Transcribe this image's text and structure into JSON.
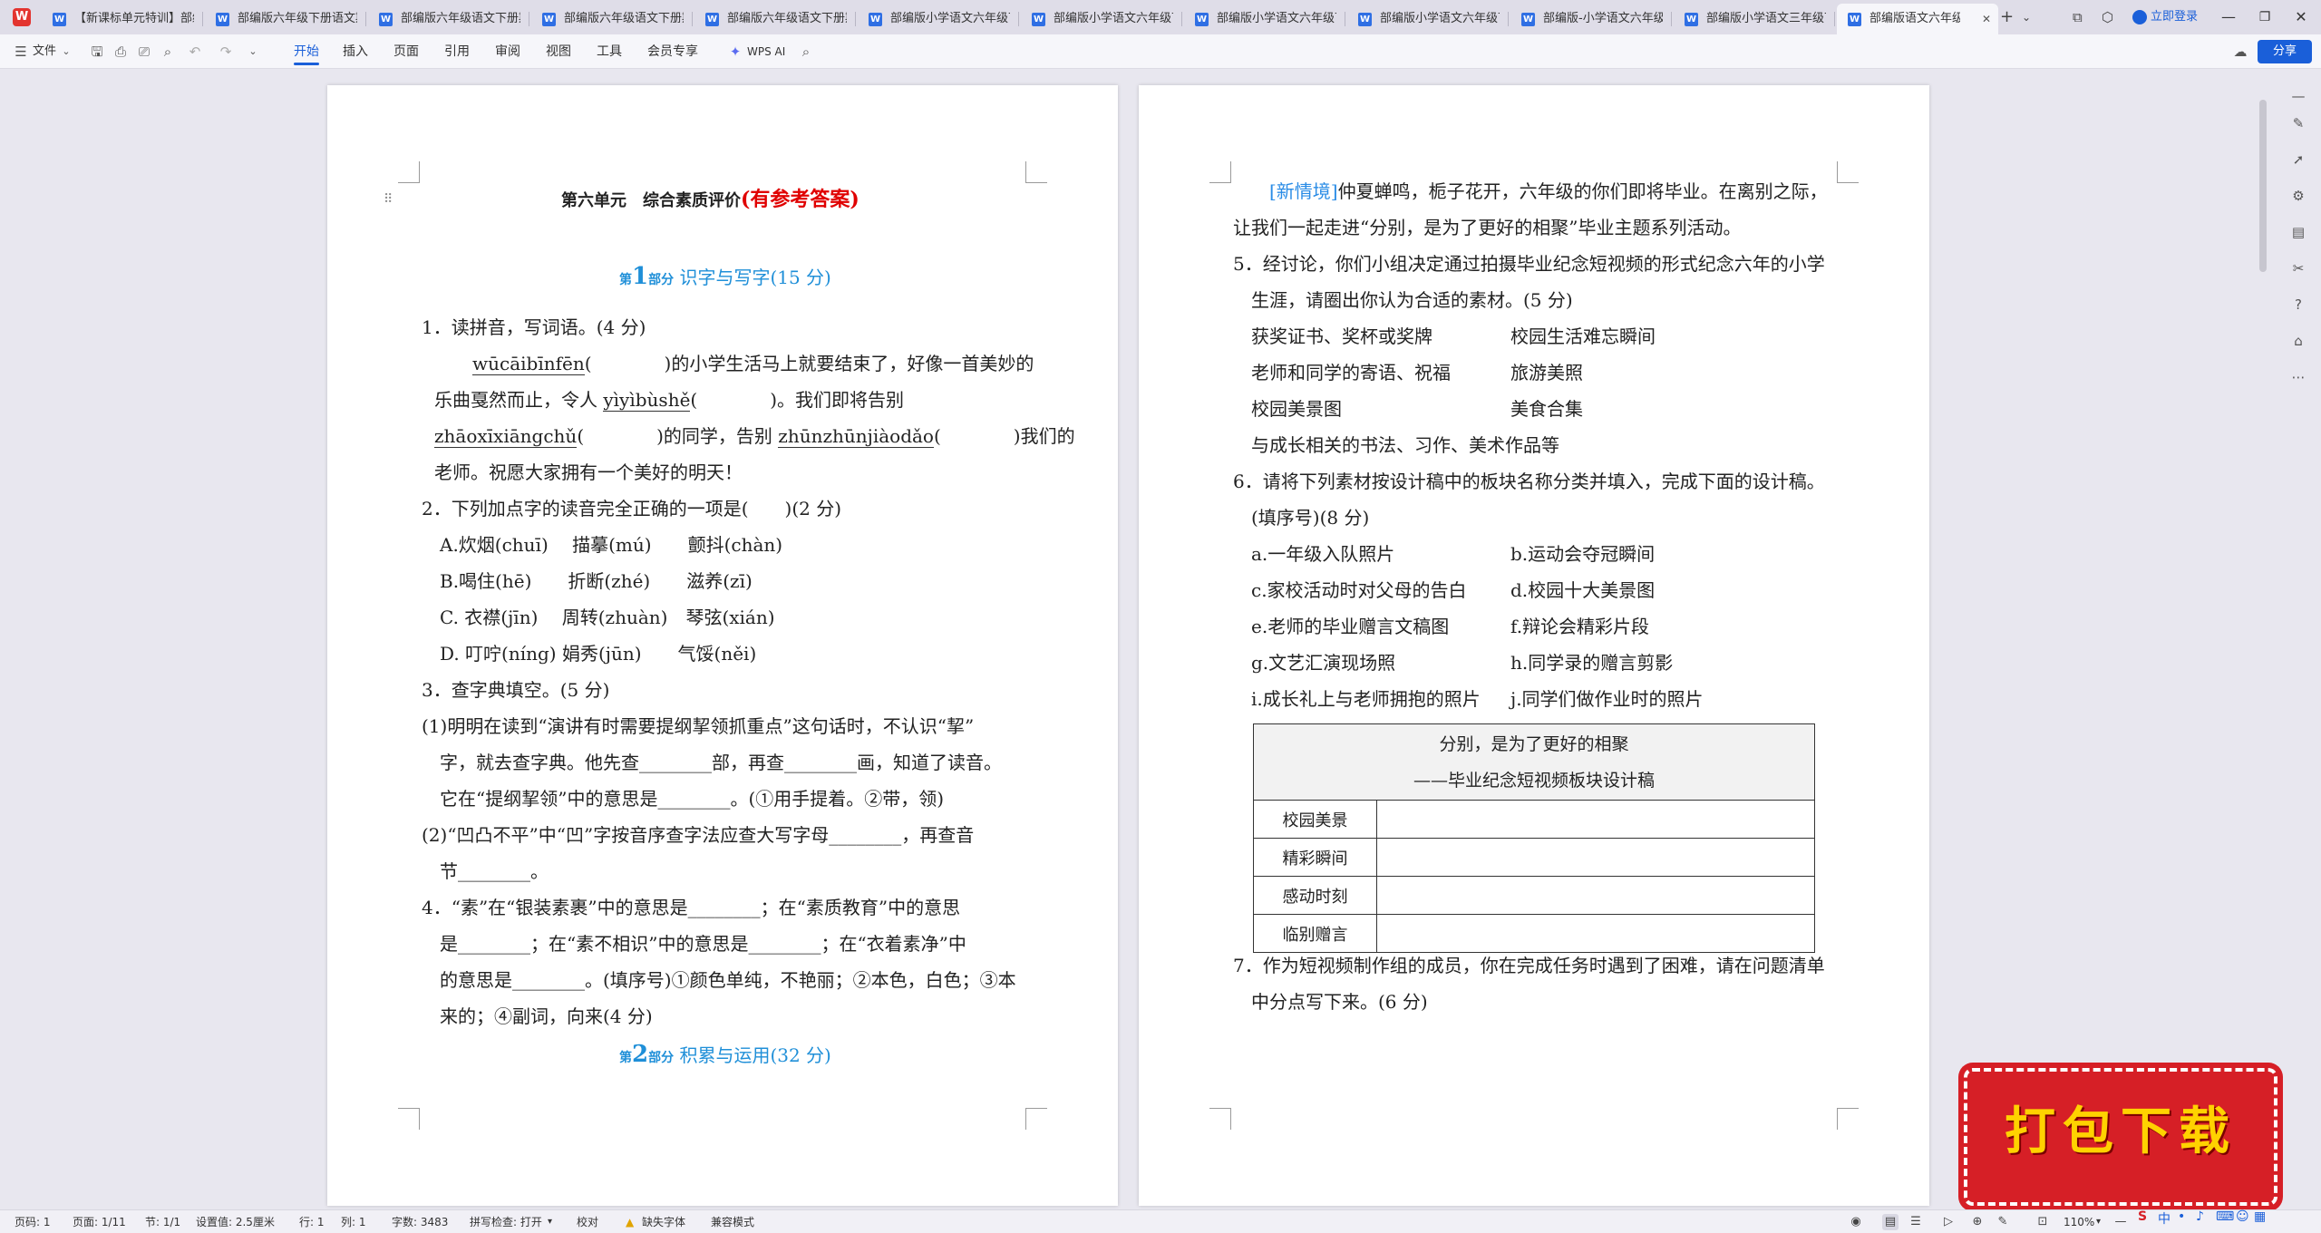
{
  "tabs": [
    {
      "label": "【新课标单元特训】部编"
    },
    {
      "label": "部编版六年级下册语文期"
    },
    {
      "label": "部编版六年级语文下册期"
    },
    {
      "label": "部编版六年级语文下册期"
    },
    {
      "label": "部编版六年级语文下册期"
    },
    {
      "label": "部编版小学语文六年级下"
    },
    {
      "label": "部编版小学语文六年级下"
    },
    {
      "label": "部编版小学语文六年级下"
    },
    {
      "label": "部编版小学语文六年级下"
    },
    {
      "label": "部编版-小学语文六年级下"
    },
    {
      "label": "部编版小学语文三年级下"
    },
    {
      "label": "部编版语文六年级"
    }
  ],
  "account": {
    "login_label": "立即登录"
  },
  "ribbon": {
    "file_label": "文件",
    "tabs": [
      "开始",
      "插入",
      "页面",
      "引用",
      "审阅",
      "视图",
      "工具",
      "会员专享"
    ],
    "wps_ai_label": "WPS AI",
    "share_label": "分享"
  },
  "page1": {
    "title_main": "第六单元　综合素质评价",
    "title_answer": "(有参考答案)",
    "section1": {
      "part_label": "第",
      "number": "1",
      "part_suffix": "部分",
      "title": "识字与写字(15 分)"
    },
    "q1": {
      "heading": "1．读拼音，写词语。(4 分)",
      "p1_pinyin": "wūcāibīnfēn",
      "p1_rest": "(　　　　)的小学生活马上就要结束了，好像一首美妙的",
      "p2_start": "乐曲戛然而止，令人 ",
      "p2_pinyin": "yìyìbùshě",
      "p2_rest": "(　　　　)。我们即将告别",
      "p3_pinyin_a": "zhāoxīxiāngchǔ",
      "p3_mid": "(　　　　)的同学，告别 ",
      "p3_pinyin_b": "zhūnzhūnjiàodǎo",
      "p3_rest": "(　　　　)我们的",
      "p4": "老师。祝愿大家拥有一个美好的明天！"
    },
    "q2": {
      "heading": "2．下列加点字的读音完全正确的一项是(　　)(2 分)",
      "options": [
        "A.炊烟(chuī)　 描摹(mú)　　颤抖(chàn)",
        "B.喝住(hē)　　折断(zhé)　　滋养(zī)",
        "C. 衣襟(jīn)　 周转(zhuàn)　琴弦(xián)",
        "D. 叮咛(níng)  娟秀(jūn)　　气馁(něi)"
      ]
    },
    "q3": {
      "heading": "3．查字典填空。(5 分)",
      "lines": [
        "(1)明明在读到“演讲有时需要提纲挈领抓重点”这句话时，不认识“挈”",
        "字，就去查字典。他先查________部，再查________画，知道了读音。",
        "它在“提纲挈领”中的意思是________。(①用手提着。②带，领)",
        "(2)“凹凸不平”中“凹”字按音序查字法应查大写字母________，再查音",
        "节________。"
      ]
    },
    "q4": {
      "lines": [
        "4．“素”在“银装素裹”中的意思是________；在“素质教育”中的意思",
        "是________；在“素不相识”中的意思是________；在“衣着素净”中",
        "的意思是________。(填序号)①颜色单纯，不艳丽；②本色，白色；③本",
        "来的；④副词，向来(4 分)"
      ]
    },
    "section2": {
      "part_label": "第",
      "number": "2",
      "part_suffix": "部分",
      "title": "积累与运用(32 分)"
    }
  },
  "page2": {
    "intro_tag": "[新情境]",
    "intro_l1": "仲夏蝉鸣，栀子花开，六年级的你们即将毕业。在离别之际，",
    "intro_l2": "让我们一起走进“分别，是为了更好的相聚”毕业主题系列活动。",
    "q5": {
      "l1": "5．经讨论，你们小组决定通过拍摄毕业纪念短视频的形式纪念六年的小学",
      "l2": "生涯，请圈出你认为合适的素材。(5 分)",
      "items_left": [
        "获奖证书、奖杯或奖牌",
        "老师和同学的寄语、祝福",
        "校园美景图"
      ],
      "items_right": [
        "校园生活难忘瞬间",
        "旅游美照",
        "美食合集"
      ],
      "last": "与成长相关的书法、习作、美术作品等"
    },
    "q6": {
      "l1": "6．请将下列素材按设计稿中的板块名称分类并填入，完成下面的设计稿。",
      "l2": "(填序号)(8 分)",
      "options_left": [
        "a.一年级入队照片",
        "c.家校活动时对父母的告白",
        "e.老师的毕业赠言文稿图",
        "g.文艺汇演现场照",
        "i.成长礼上与老师拥抱的照片"
      ],
      "options_right": [
        "b.运动会夺冠瞬间",
        "d.校园十大美景图",
        "f.辩论会精彩片段",
        "h.同学录的赠言剪影",
        "j.同学们做作业时的照片"
      ],
      "table_title": "分别，是为了更好的相聚",
      "table_subtitle": "——毕业纪念短视频板块设计稿",
      "rows": [
        "校园美景",
        "精彩瞬间",
        "感动时刻",
        "临别赠言"
      ]
    },
    "q7": {
      "l1": "7．作为短视频制作组的成员，你在完成任务时遇到了困难，请在问题清单",
      "l2": "中分点写下来。(6 分)"
    }
  },
  "status": {
    "page_num": "页码: 1",
    "pages": "页面: 1/11",
    "section": "节: 1/1",
    "setting": "设置值: 2.5厘米",
    "row": "行: 1",
    "col": "列: 1",
    "word_count": "字数: 3483",
    "spell": "拼写检查: 打开",
    "proof": "校对",
    "missing_font": "缺失字体",
    "compat": "兼容模式",
    "zoom": "110%"
  },
  "ime": {
    "label": "中"
  },
  "banner": {
    "text": "打包下载"
  },
  "colors": {
    "accent": "#1a5fd9",
    "red_title": "#e00000",
    "section_blue": "#1f8fd8",
    "banner_red": "#d61f26",
    "banner_text": "#ffd200"
  }
}
